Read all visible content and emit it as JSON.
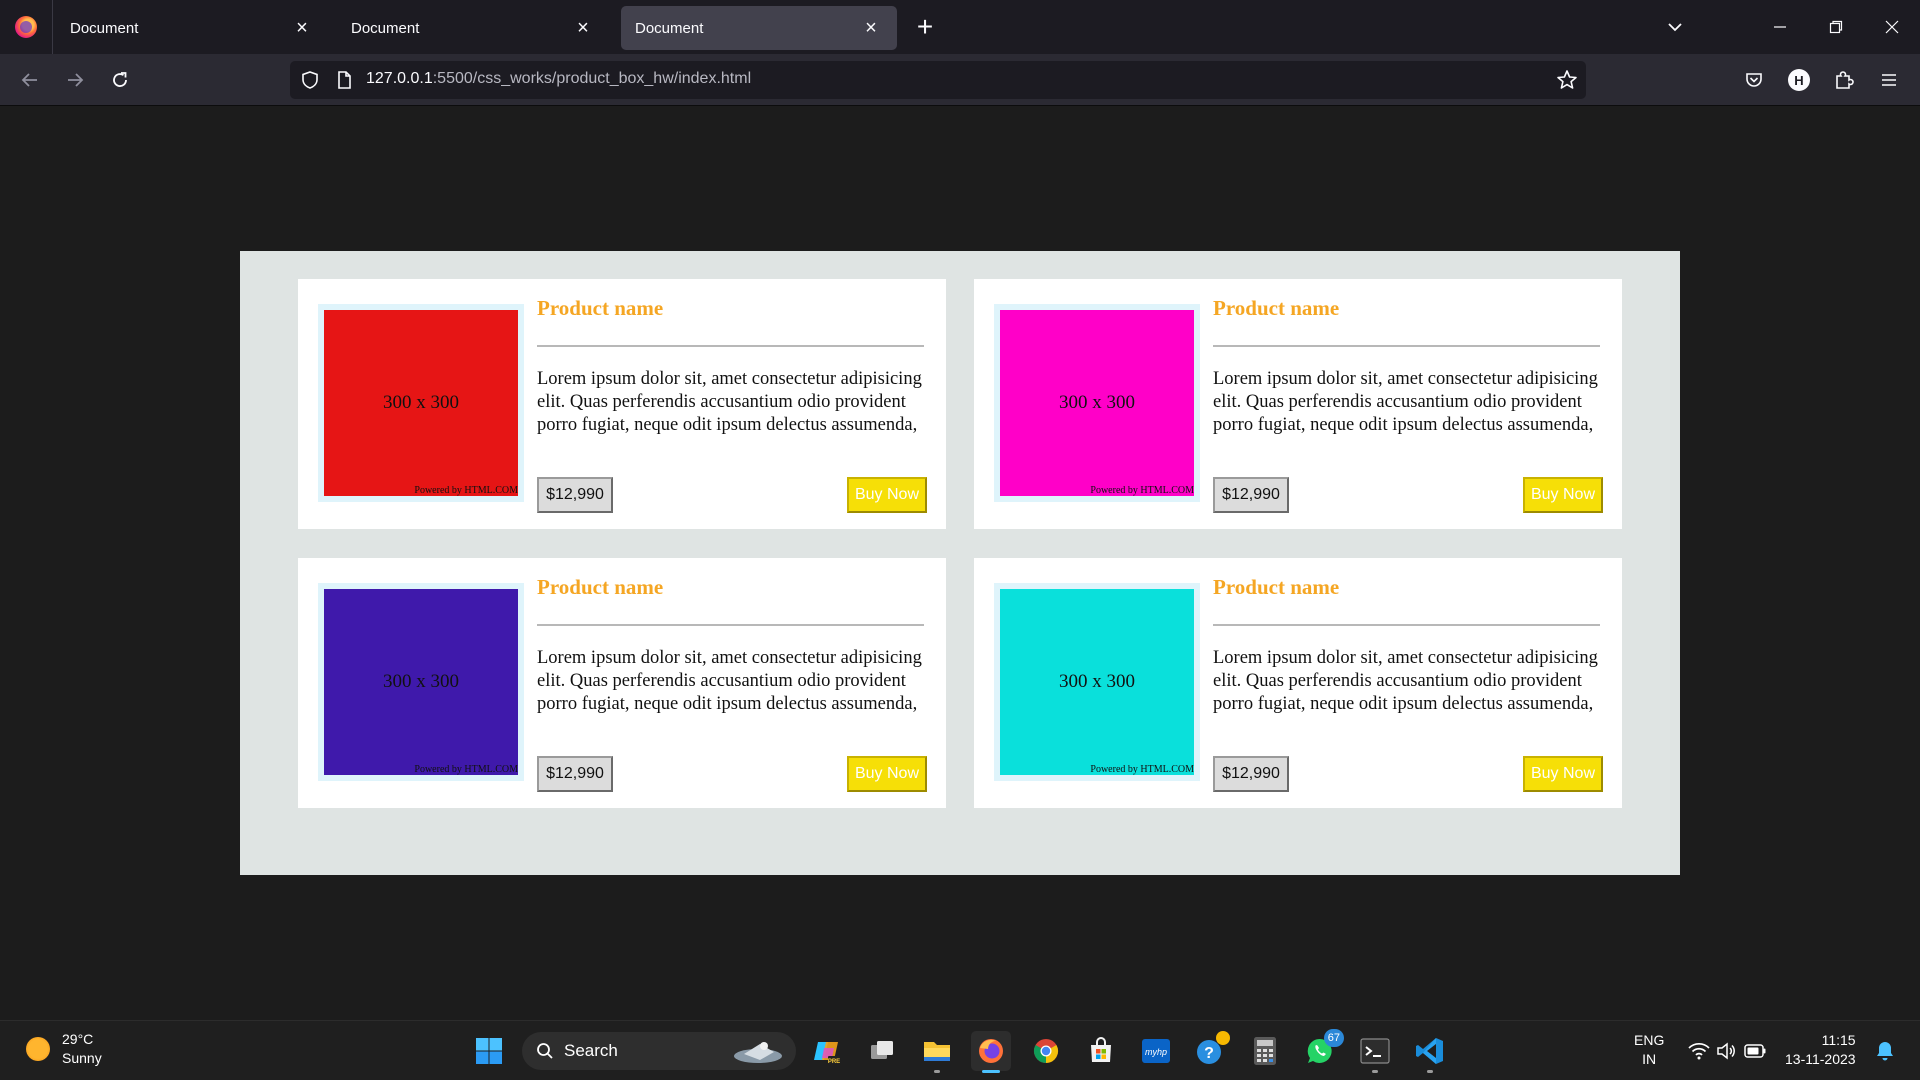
{
  "browser": {
    "tabs": [
      {
        "title": "Document",
        "active": false
      },
      {
        "title": "Document",
        "active": false
      },
      {
        "title": "Document",
        "active": true
      }
    ],
    "url_host": "127.0.0.1",
    "url_path": ":5500/css_works/product_box_hw/index.html",
    "profile_initial": "H"
  },
  "page": {
    "colors": {
      "page_background": "#1c1c1c",
      "container_background": "#dfe4e3",
      "title_color": "#f5a623",
      "buy_button_color": "#f6df07"
    },
    "products": [
      {
        "image_label": "300 x 300",
        "image_color": "#e61515",
        "powered_by": "Powered by HTML.COM",
        "name": "Product name",
        "description": "Lorem ipsum dolor sit, amet consectetur adipisicing elit. Quas perferendis accusantium odio provident porro fugiat, neque odit ipsum delectus assumenda,",
        "price": "$12,990",
        "buy_label": "Buy Now"
      },
      {
        "image_label": "300 x 300",
        "image_color": "#ff00c8",
        "powered_by": "Powered by HTML.COM",
        "name": "Product name",
        "description": "Lorem ipsum dolor sit, amet consectetur adipisicing elit. Quas perferendis accusantium odio provident porro fugiat, neque odit ipsum delectus assumenda,",
        "price": "$12,990",
        "buy_label": "Buy Now"
      },
      {
        "image_label": "300 x 300",
        "image_color": "#3f19ab",
        "powered_by": "Powered by HTML.COM",
        "name": "Product name",
        "description": "Lorem ipsum dolor sit, amet consectetur adipisicing elit. Quas perferendis accusantium odio provident porro fugiat, neque odit ipsum delectus assumenda,",
        "price": "$12,990",
        "buy_label": "Buy Now"
      },
      {
        "image_label": "300 x 300",
        "image_color": "#0ae0db",
        "powered_by": "Powered by HTML.COM",
        "name": "Product name",
        "description": "Lorem ipsum dolor sit, amet consectetur adipisicing elit. Quas perferendis accusantium odio provident porro fugiat, neque odit ipsum delectus assumenda,",
        "price": "$12,990",
        "buy_label": "Buy Now"
      }
    ]
  },
  "taskbar": {
    "weather_temp": "29°C",
    "weather_desc": "Sunny",
    "search_label": "Search",
    "whatsapp_badge": "67",
    "lang_line1": "ENG",
    "lang_line2": "IN",
    "time": "11:15",
    "date": "13-11-2023",
    "icons": [
      "windows-start-icon",
      "copilot-icon",
      "task-view-icon",
      "file-explorer-icon",
      "firefox-icon",
      "chrome-icon",
      "ms-store-icon",
      "myhp-icon",
      "get-help-icon",
      "calculator-icon",
      "whatsapp-icon",
      "terminal-icon",
      "vscode-icon"
    ]
  }
}
